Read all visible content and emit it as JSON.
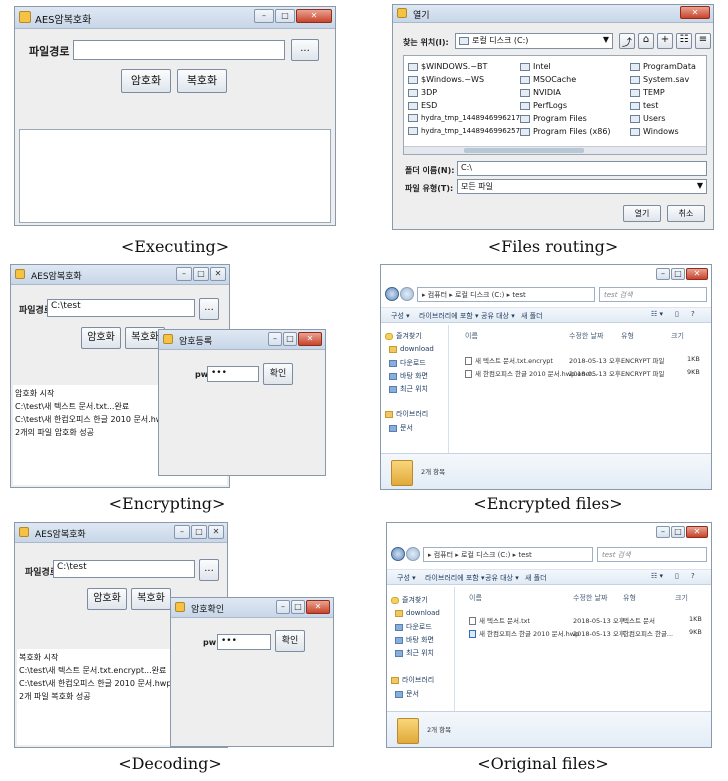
{
  "captions": {
    "executing": "<Executing>",
    "files_routing": "<Files routing>",
    "encrypting": "<Encrypting>",
    "encrypted_files": "<Encrypted files>",
    "decoding": "<Decoding>",
    "original_files": "<Original files>"
  },
  "executing": {
    "title": "AES암복호화",
    "path_label": "파일경로",
    "path_value": "",
    "browse_label": "...",
    "encrypt_label": "암호화",
    "decrypt_label": "복호화"
  },
  "files_routing": {
    "title": "열기",
    "look_in_label": "찾는 위치(I):",
    "look_in_value": "로컬 디스크 (C:)",
    "folders": [
      "$WINDOWS.~BT",
      "$Windows.~WS",
      "3DP",
      "ESD",
      "hydra_tmp_1448946996217",
      "hydra_tmp_1448946996257",
      "Intel",
      "MSOCache",
      "NVIDIA",
      "PerfLogs",
      "Program Files",
      "Program Files (x86)",
      "ProgramData",
      "System.sav",
      "TEMP",
      "test",
      "Users",
      "Windows"
    ],
    "folder_name_label": "폴더 이름(N):",
    "folder_name_value": "C:\\",
    "file_type_label": "파일 유형(T):",
    "file_type_value": "모든 파일",
    "open_label": "열기",
    "cancel_label": "취소"
  },
  "encrypting": {
    "title": "AES암복호화",
    "path_label": "파일경로",
    "path_value": "C:\\test",
    "browse_label": "...",
    "encrypt_label": "암호화",
    "decrypt_label": "복호화",
    "log": [
      "암호화 시작",
      "C:\\test\\새 텍스트 문서.txt...완료",
      "C:\\test\\새 한컴오피스 한글 2010 문서.hwp...완료",
      "2개의 파일 암호화 성공"
    ],
    "dialog": {
      "title": "암호등록",
      "pw_label": "pw:",
      "pw_value": "•••",
      "ok_label": "확인"
    }
  },
  "encrypted_files": {
    "breadcrumb": "▸ 컴퓨터 ▸ 로컬 디스크 (C:) ▸ test",
    "search_placeholder": "test 검색",
    "commands": [
      "구성 ▾",
      "라이브러리에 포함 ▾",
      "공유 대상 ▾",
      "새 폴더"
    ],
    "nav": [
      "즐겨찾기",
      "download",
      "다운로드",
      "바탕 화면",
      "최근 위치",
      "라이브러리",
      "문서"
    ],
    "columns": [
      "이름",
      "수정한 날짜",
      "유형",
      "크기"
    ],
    "rows": [
      {
        "name": "새 텍스트 문서.txt.encrypt",
        "date": "2018-05-13 오후...",
        "type": "ENCRYPT 파일",
        "size": "1KB"
      },
      {
        "name": "새 한컴오피스 한글 2010 문서.hwp.encr...",
        "date": "2018-05-13 오후...",
        "type": "ENCRYPT 파일",
        "size": "9KB"
      }
    ],
    "count": "2개 항목"
  },
  "decoding": {
    "title": "AES암복호화",
    "path_label": "파일경로",
    "path_value": "C:\\test",
    "browse_label": "...",
    "encrypt_label": "암호화",
    "decrypt_label": "복호화",
    "log": [
      "복호화 시작",
      "C:\\test\\새 텍스트 문서.txt.encrypt...완료",
      "C:\\test\\새 한컴오피스 한글 2010 문서.hwp.encrypt...완료",
      "2개 파일 복호화 성공"
    ],
    "dialog": {
      "title": "암호확인",
      "pw_label": "pw:",
      "pw_value": "•••",
      "ok_label": "확인"
    }
  },
  "original_files": {
    "breadcrumb": "▸ 컴퓨터 ▸ 로컬 디스크 (C:) ▸ test",
    "search_placeholder": "test 검색",
    "commands": [
      "구성 ▾",
      "라이브러리에 포함 ▾",
      "공유 대상 ▾",
      "새 폴더"
    ],
    "nav": [
      "즐겨찾기",
      "download",
      "다운로드",
      "바탕 화면",
      "최근 위치",
      "라이브러리",
      "문서"
    ],
    "columns": [
      "이름",
      "수정한 날짜",
      "유형",
      "크기"
    ],
    "rows": [
      {
        "name": "새 텍스트 문서.txt",
        "date": "2018-05-13 오후...",
        "type": "텍스트 문서",
        "size": "1KB"
      },
      {
        "name": "새 한컴오피스 한글 2010 문서.hwp",
        "date": "2018-05-13 오후...",
        "type": "한컴오피스 한글...",
        "size": "9KB"
      }
    ],
    "count": "2개 항목"
  }
}
